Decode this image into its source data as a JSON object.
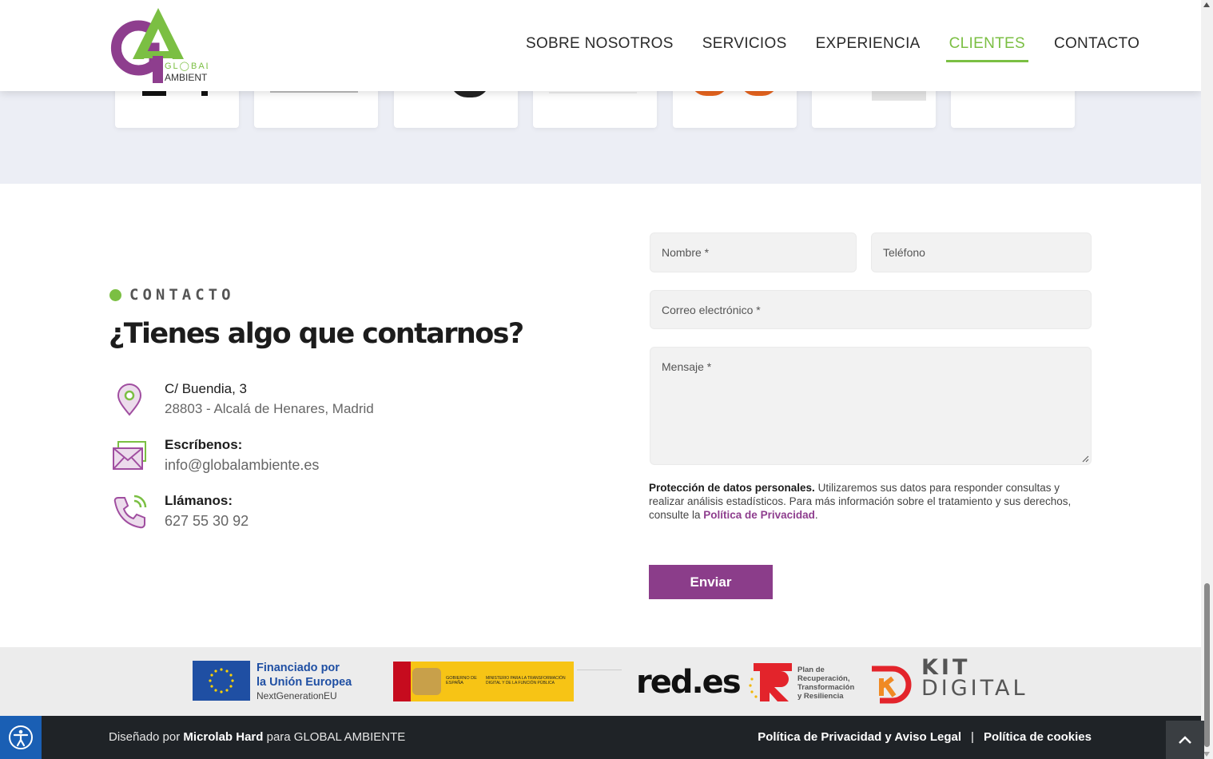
{
  "colors": {
    "accent_green": "#7bbf43",
    "brand_purple": "#8b3d8a",
    "footer_bg": "#1f2327",
    "band_bg": "#eceef5"
  },
  "logo": {
    "letters": "GA",
    "line1": "GL◯BAL",
    "line2": "AMBIENTE"
  },
  "nav": {
    "items": [
      {
        "label": "SOBRE NOSOTROS"
      },
      {
        "label": "SERVICIOS"
      },
      {
        "label": "EXPERIENCIA"
      },
      {
        "label": "CLIENTES"
      },
      {
        "label": "CONTACTO"
      }
    ],
    "active": "CLIENTES"
  },
  "contact": {
    "eyebrow": "CONTACTO",
    "heading": "¿Tienes algo que contarnos?",
    "address_line1": "C/ Buendia, 3",
    "address_line2": "28803 - Alcalá de Henares, Madrid",
    "email_label": "Escríbenos:",
    "email_value": "info@globalambiente.es",
    "phone_label": "Llámanos:",
    "phone_value": "627 55 30 92",
    "icons": [
      "location-pin-icon",
      "envelope-icon",
      "phone-icon"
    ]
  },
  "form": {
    "name_placeholder": "Nombre *",
    "phone_placeholder": "Teléfono",
    "email_placeholder": "Correo electrónico *",
    "message_placeholder": "Mensaje *",
    "privacy_bold": "Protección de datos personales.",
    "privacy_text": " Utilizaremos sus datos para responder consultas y realizar análisis estadísticos. Para más información sobre el tratamiento y sus derechos, consulte la ",
    "privacy_link": "Política de Privacidad",
    "privacy_end": ".",
    "submit": "Enviar"
  },
  "funding": {
    "eu_line1": "Financiado por",
    "eu_line2": "la Unión Europea",
    "eu_line3": "NextGenerationEU",
    "gob_text": "GOBIERNO DE ESPAÑA",
    "ministerio_text": "MINISTERIO PARA LA TRANSFORMACIÓN DIGITAL Y DE LA FUNCIÓN PÚBLICA",
    "red_es": "red.es",
    "plan_line1": "Plan de",
    "plan_line2": "Recuperación,",
    "plan_line3": "Transformación",
    "plan_line4": "y Resiliencia",
    "kit_line1": "KIT",
    "kit_line2": "DIGITAL"
  },
  "footer": {
    "designed_prefix": "Diseñado por ",
    "designer": "Microlab Hard",
    "designed_mid": " para GLOBAL AMBIENTE",
    "legal_link": "Política de Privacidad y Aviso Legal",
    "separator": "|",
    "cookies_link": "Política de cookies"
  }
}
